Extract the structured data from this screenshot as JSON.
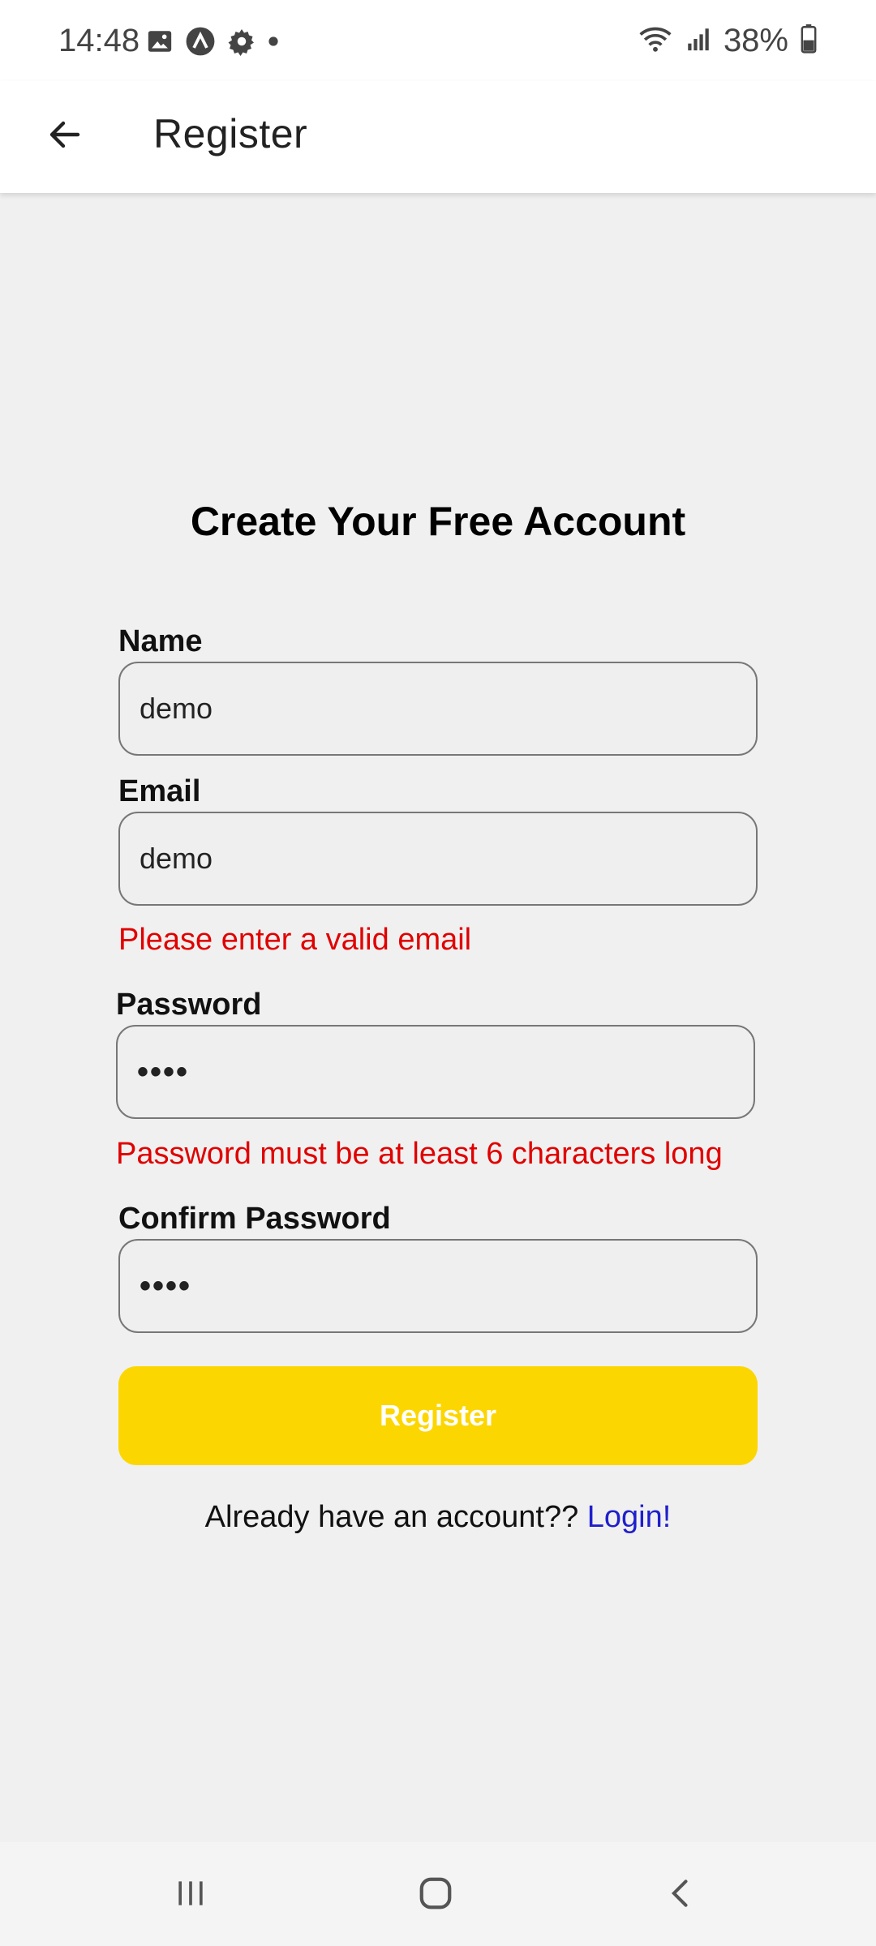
{
  "status_bar": {
    "time": "14:48",
    "battery": "38%",
    "left_icons": [
      "gallery-icon",
      "app-icon",
      "settings-icon",
      "dot-icon"
    ],
    "right_icons": [
      "wifi-icon",
      "signal-icon",
      "battery-icon"
    ]
  },
  "app_bar": {
    "title": "Register"
  },
  "form": {
    "title": "Create Your Free Account",
    "name": {
      "label": "Name",
      "value": "demo"
    },
    "email": {
      "label": "Email",
      "value": "demo",
      "error": "Please enter a valid email"
    },
    "password": {
      "label": "Password",
      "value": "••••",
      "error": "Password must be at least 6 characters long"
    },
    "confirm_password": {
      "label": "Confirm Password",
      "value": "••••"
    },
    "submit_label": "Register",
    "login_prompt": "Already have an account?? ",
    "login_link": "Login!"
  },
  "colors": {
    "button": "#fcd600",
    "error": "#e00000",
    "link": "#1f1fcc"
  },
  "nav_bar": {
    "items": [
      "recents-icon",
      "home-icon",
      "back-icon"
    ]
  }
}
